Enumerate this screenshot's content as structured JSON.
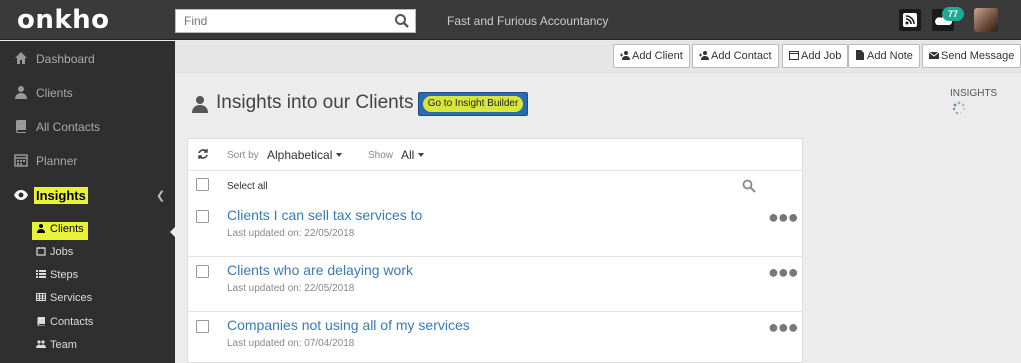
{
  "app": {
    "logo": "onkho",
    "company": "Fast and Furious Accountancy"
  },
  "search": {
    "placeholder": "Find"
  },
  "notifications": {
    "count": "77"
  },
  "sidebar": {
    "items": [
      {
        "label": "Dashboard"
      },
      {
        "label": "Clients"
      },
      {
        "label": "All Contacts"
      },
      {
        "label": "Planner"
      },
      {
        "label": "Insights"
      }
    ],
    "subitems": [
      {
        "label": "Clients"
      },
      {
        "label": "Jobs"
      },
      {
        "label": "Steps"
      },
      {
        "label": "Services"
      },
      {
        "label": "Contacts"
      },
      {
        "label": "Team"
      }
    ]
  },
  "actions": {
    "add_client": "Add Client",
    "add_contact": "Add Contact",
    "add_job": "Add Job",
    "add_note": "Add Note",
    "send_message": "Send Message"
  },
  "page": {
    "title": "Insights into our Clients",
    "insight_builder": "Go to Insight Builder",
    "insights_label": "INSIGHTS"
  },
  "list": {
    "sort_label": "Sort by",
    "sort_value": "Alphabetical",
    "show_label": "Show",
    "show_value": "All",
    "select_all": "Select all",
    "rows": [
      {
        "title": "Clients I can sell tax services to",
        "updated": "Last updated on: 22/05/2018"
      },
      {
        "title": "Clients who are delaying work",
        "updated": "Last updated on: 22/05/2018"
      },
      {
        "title": "Companies not using all of my services",
        "updated": "Last updated on: 07/04/2018"
      }
    ]
  },
  "colors": {
    "accent": "#e8f238",
    "link": "#3a7ab8",
    "badge": "#1aaa96",
    "sidebar": "#2f2f2f",
    "topbar": "#3a3a3a"
  }
}
